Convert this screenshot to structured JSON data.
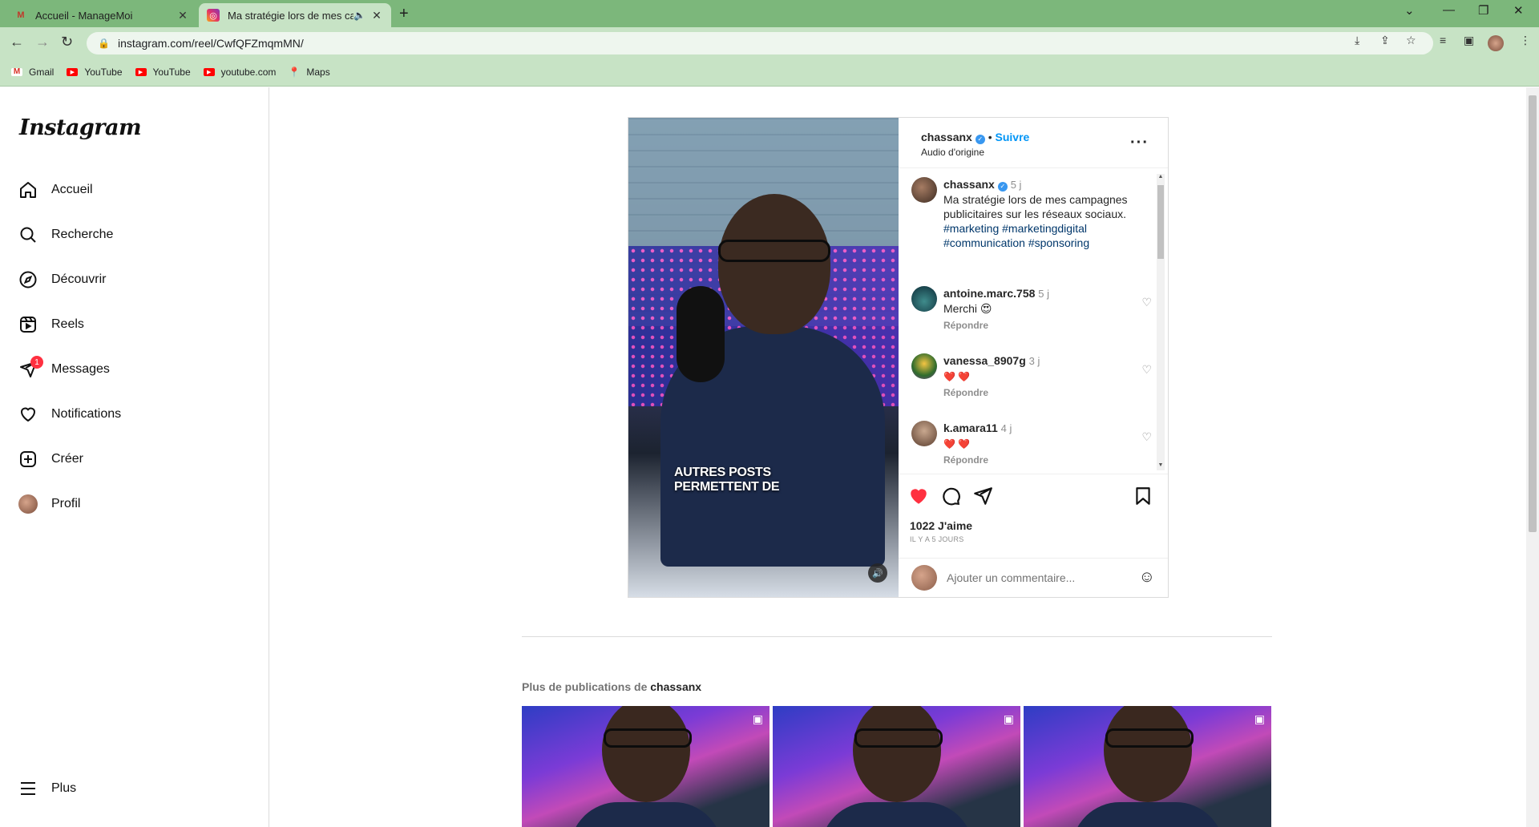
{
  "browser": {
    "tabs": [
      {
        "title": "Accueil - ManageMoi",
        "active": false
      },
      {
        "title": "Ma stratégie lors de mes campagnes",
        "active": true
      }
    ],
    "url": "instagram.com/reel/CwfQFZmqmMN/",
    "bookmarks": [
      "Gmail",
      "YouTube",
      "YouTube",
      "youtube.com",
      "Maps"
    ]
  },
  "sidebar": {
    "logo": "Instagram",
    "items": [
      {
        "label": "Accueil",
        "icon": "home-icon"
      },
      {
        "label": "Recherche",
        "icon": "search-icon"
      },
      {
        "label": "Découvrir",
        "icon": "compass-icon"
      },
      {
        "label": "Reels",
        "icon": "reels-icon"
      },
      {
        "label": "Messages",
        "icon": "messages-icon",
        "badge": "1"
      },
      {
        "label": "Notifications",
        "icon": "heart-icon"
      },
      {
        "label": "Créer",
        "icon": "create-icon"
      },
      {
        "label": "Profil",
        "icon": "avatar"
      }
    ],
    "more": "Plus"
  },
  "post": {
    "username": "chassanx",
    "follow": "Suivre",
    "separator": "•",
    "audio": "Audio d'origine",
    "video_caption": "AUTRES POSTS PERMETTENT DE",
    "comments": [
      {
        "user": "chassanx",
        "age": "5 j",
        "text": "Ma stratégie lors de mes campagnes publicitaires sur les réseaux sociaux.",
        "tags": "#marketing #marketingdigital #communication #sponsoring"
      },
      {
        "user": "antoine.marc.758",
        "age": "5 j",
        "text": "Merchi 😍",
        "reply": "Répondre"
      },
      {
        "user": "vanessa_8907g",
        "age": "3 j",
        "text": "❤️ ❤️",
        "reply": "Répondre"
      },
      {
        "user": "k.amara11",
        "age": "4 j",
        "text": "❤️ ❤️",
        "reply": "Répondre"
      }
    ],
    "likes": "1022 J'aime",
    "time": "IL Y A 5 JOURS",
    "add_comment_placeholder": "Ajouter un commentaire..."
  },
  "more_posts": {
    "prefix": "Plus de publications de",
    "user": "chassanx"
  },
  "colors": {
    "chrome_tab_strip": "#7cb77b",
    "chrome_toolbar": "#c7e3c5",
    "like_red": "#ff3040",
    "link_blue": "#0095f6"
  }
}
